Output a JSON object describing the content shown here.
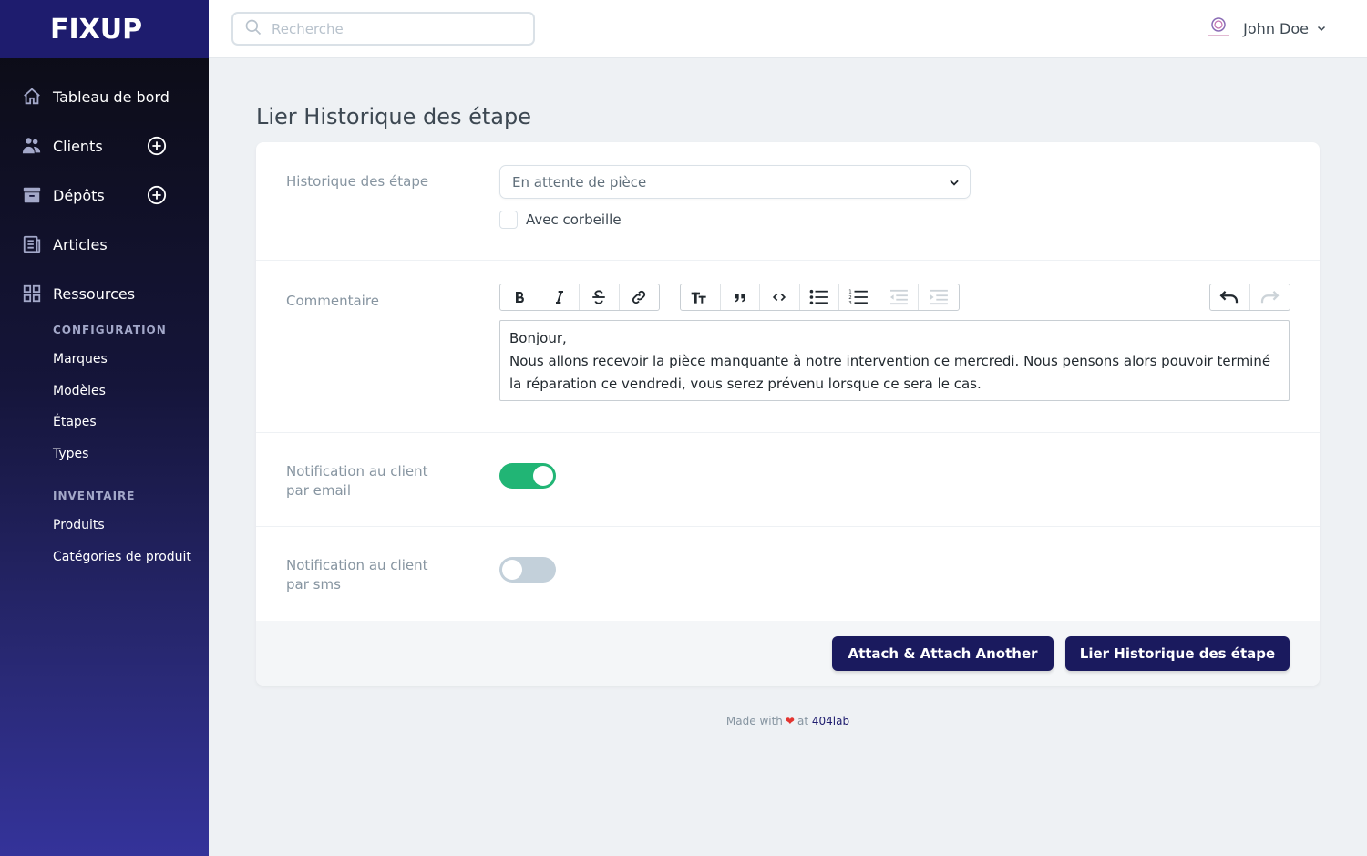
{
  "app": {
    "logo": "FIXUP"
  },
  "sidebar": {
    "items": [
      {
        "label": "Tableau de bord",
        "icon": "home-icon"
      },
      {
        "label": "Clients",
        "icon": "users-icon",
        "has_add": true
      },
      {
        "label": "Dépôts",
        "icon": "archive-icon",
        "has_add": true
      },
      {
        "label": "Articles",
        "icon": "newspaper-icon"
      },
      {
        "label": "Ressources",
        "icon": "grid-icon"
      }
    ],
    "sections": [
      {
        "title": "Configuration",
        "items": [
          "Marques",
          "Modèles",
          "Étapes",
          "Types"
        ]
      },
      {
        "title": "Inventaire",
        "items": [
          "Produits",
          "Catégories de produit"
        ]
      }
    ]
  },
  "header": {
    "search_placeholder": "Recherche",
    "user_name": "John Doe"
  },
  "page": {
    "title": "Lier Historique des étape",
    "form": {
      "historique_label": "Historique des étape",
      "historique_value": "En attente de pièce",
      "corbeille_label": "Avec corbeille",
      "commentaire_label": "Commentaire",
      "commentaire_line1": "Bonjour,",
      "commentaire_line2": "Nous allons recevoir la pièce manquante à notre intervention ce mercredi. Nous pensons alors pouvoir terminé la réparation ce vendredi, vous serez prévenu lorsque ce sera le cas.",
      "notif_email_label_1": "Notification au client",
      "notif_email_label_2": "par email",
      "notif_email_on": true,
      "notif_sms_label_1": "Notification au client",
      "notif_sms_label_2": "par sms",
      "notif_sms_on": false
    },
    "buttons": {
      "attach_another": "Attach & Attach Another",
      "submit": "Lier Historique des étape"
    }
  },
  "footer": {
    "made_with": "Made with",
    "at": "at",
    "brand": "404lab"
  },
  "colors": {
    "primary": "#1a1a5e",
    "toggle_on": "#21b575",
    "toggle_off": "#c3d0da"
  }
}
